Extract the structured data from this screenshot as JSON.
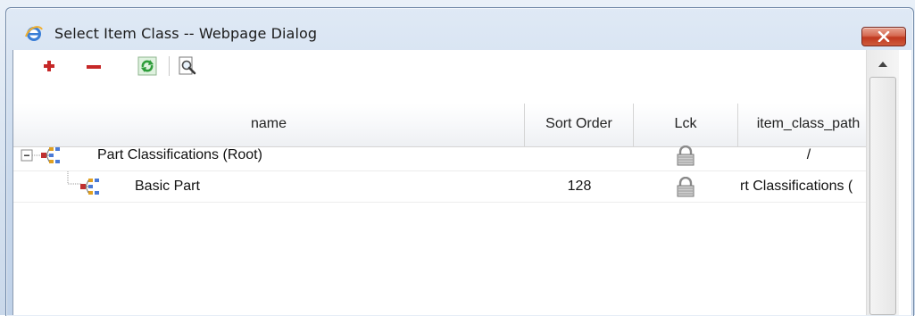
{
  "window": {
    "title": "Select Item Class -- Webpage Dialog"
  },
  "toolbar": {
    "icons": [
      "plus-icon",
      "minus-icon",
      "refresh-icon",
      "preview-icon"
    ]
  },
  "grid": {
    "columns": [
      "name",
      "Sort Order",
      "Lck",
      "item_class_path"
    ],
    "rows": [
      {
        "name": "Part Classifications (Root)",
        "sort_order": "",
        "lock_icon": "lock-icon",
        "path": "/"
      },
      {
        "name": "Basic Part",
        "sort_order": "128",
        "lock_icon": "lock-icon",
        "path": "rt Classifications ("
      }
    ]
  },
  "colors": {
    "title_bar": "#c8d8ec",
    "close_button": "#c0391f",
    "add_icon": "#c62828",
    "remove_icon": "#c62828",
    "refresh_icon": "#2e9d3a"
  }
}
